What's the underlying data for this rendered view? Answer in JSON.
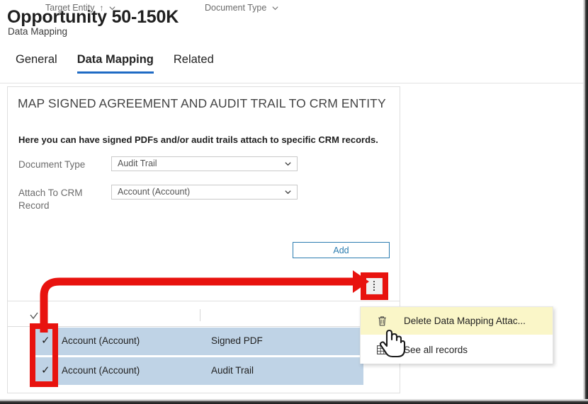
{
  "header": {
    "title": "Opportunity 50-150K",
    "subtitle": "Data Mapping",
    "tabs": [
      {
        "label": "General",
        "active": false
      },
      {
        "label": "Data Mapping",
        "active": true
      },
      {
        "label": "Related",
        "active": false
      }
    ]
  },
  "card": {
    "title": "MAP SIGNED AGREEMENT AND AUDIT TRAIL TO CRM ENTITY",
    "description": "Here you can have signed PDFs and/or audit trails attach to specific CRM records.",
    "fields": [
      {
        "label": "Document Type",
        "value": "Audit Trail",
        "icon": "chevron-down-icon"
      },
      {
        "label": "Attach To CRM Record",
        "value": "Account (Account)",
        "icon": "chevron-down-icon"
      }
    ],
    "add_button": "Add",
    "overflow_button_icon": "kebab-menu-icon"
  },
  "grid": {
    "columns": [
      {
        "label": "Target Entity",
        "sort_indicator": "↑",
        "caret": "chevron-down-icon"
      },
      {
        "label": "Document Type",
        "sort_indicator": "",
        "caret": "chevron-down-icon"
      }
    ],
    "select_all_icon": "select-all-checkbox",
    "rows": [
      {
        "selected": true,
        "check": "✓",
        "target_entity": "Account (Account)",
        "document_type": "Signed PDF"
      },
      {
        "selected": true,
        "check": "✓",
        "target_entity": "Account (Account)",
        "document_type": "Audit Trail"
      }
    ],
    "selection_color": "#bfd3e6"
  },
  "context_menu": {
    "items": [
      {
        "label": "Delete Data Mapping Attac...",
        "icon": "trash-icon",
        "highlighted": true
      },
      {
        "label": "See all records",
        "icon": "grid-icon",
        "highlighted": false
      }
    ],
    "highlight_color": "#faf6c8"
  },
  "annotations": {
    "color": "#e8130f",
    "arrow_label": "arrow-to-overflow-button",
    "box_checkboxes_label": "highlight-row-checkboxes",
    "box_overflow_label": "highlight-overflow-button",
    "cursor": "hand-pointer-cursor"
  }
}
